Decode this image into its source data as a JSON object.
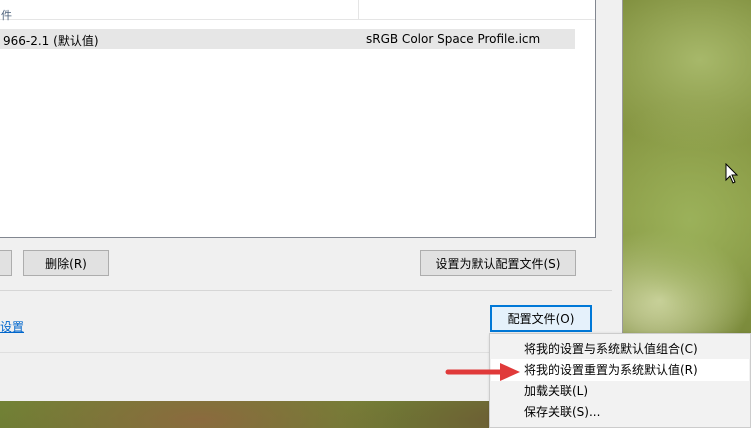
{
  "list": {
    "header_label": "件",
    "rows": [
      {
        "name": "966-2.1 (默认值)",
        "file": "sRGB Color Space Profile.icm"
      }
    ]
  },
  "buttons": {
    "delete": "删除(R)",
    "set_default": "设置为默认配置文件(S)",
    "profile": "配置文件(O)"
  },
  "link": {
    "label": "设置"
  },
  "context_menu": {
    "items": [
      "将我的设置与系统默认值组合(C)",
      "将我的设置重置为系统默认值(R)",
      "加载关联(L)",
      "保存关联(S)..."
    ],
    "highlighted_index": 1
  },
  "annotation": {
    "arrow_color": "#e03a3a"
  },
  "colors": {
    "link": "#0066cc",
    "focus_border": "#0078d7"
  }
}
